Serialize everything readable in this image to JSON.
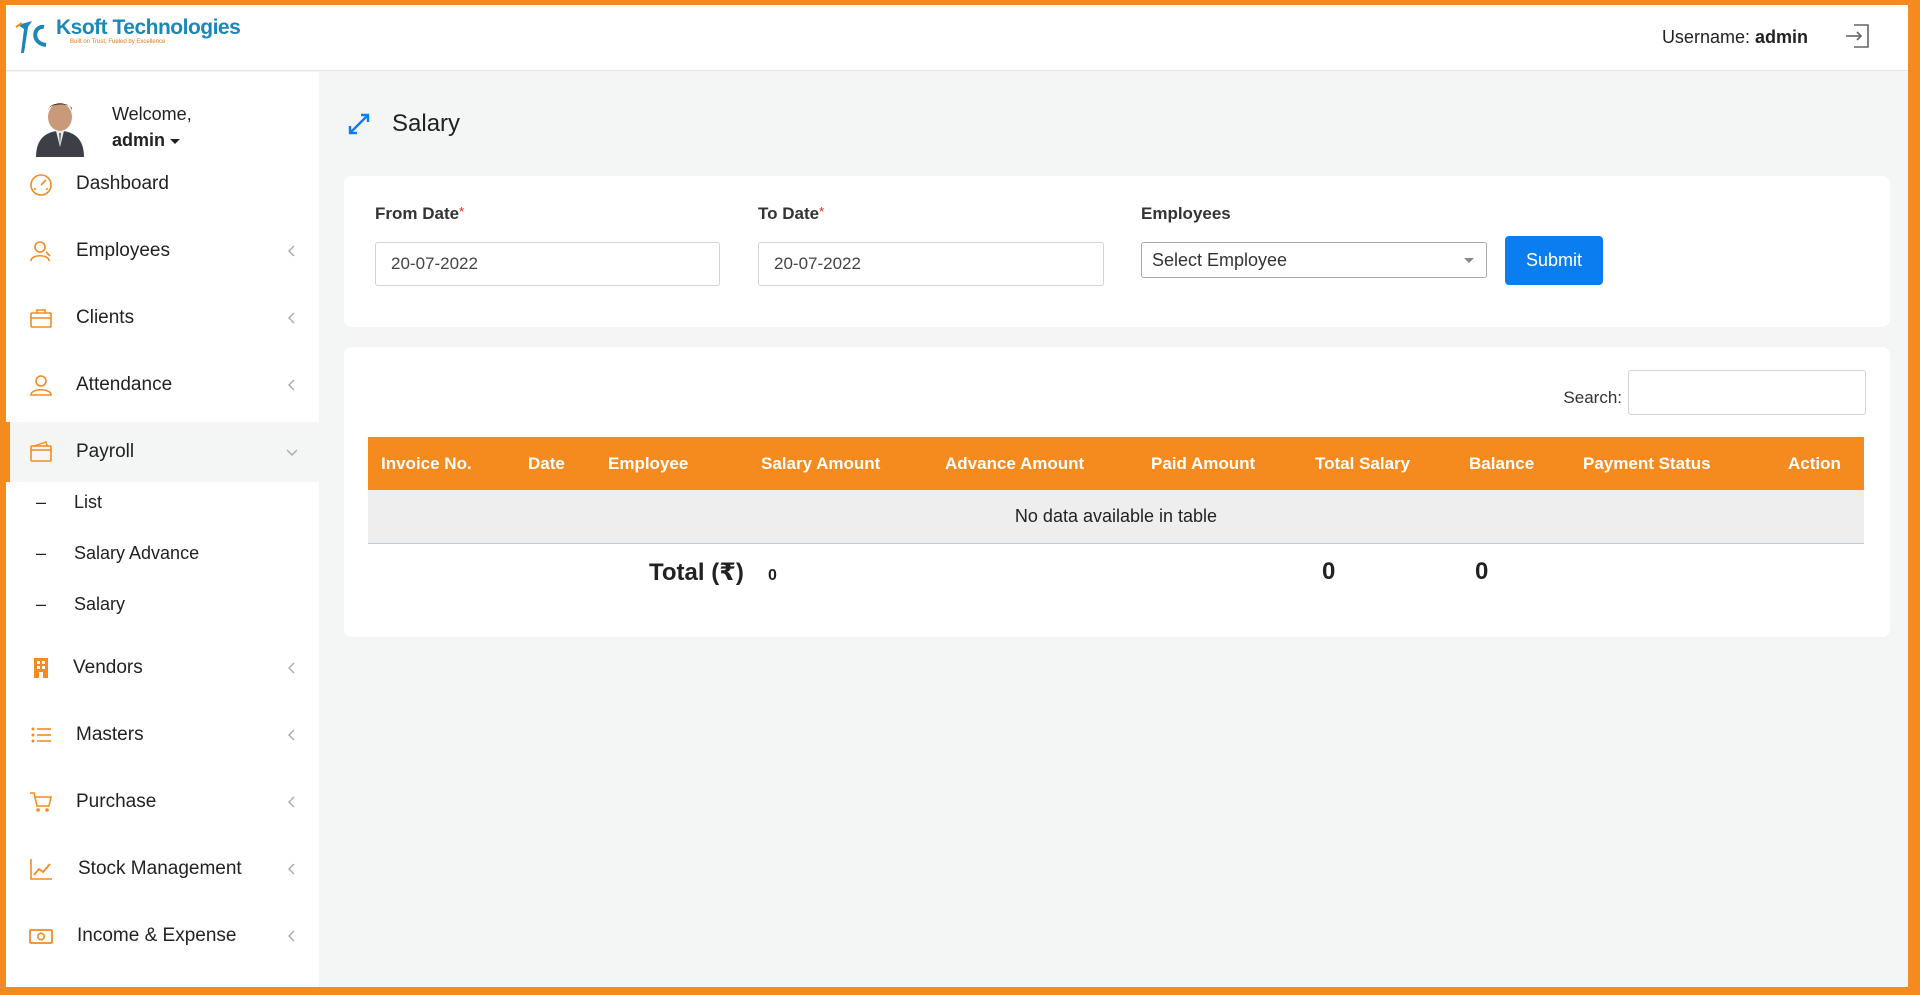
{
  "brand": {
    "name": "Ksoft Technologies",
    "tagline": "Built on Trust, Fueled by Excellence"
  },
  "header": {
    "username_label": "Username:",
    "username": "admin"
  },
  "sidebar": {
    "welcome": "Welcome,",
    "user": "admin",
    "items": [
      {
        "label": "Dashboard",
        "icon": "dashboard-gauge-icon"
      },
      {
        "label": "Employees",
        "icon": "employees-icon"
      },
      {
        "label": "Clients",
        "icon": "briefcase-icon"
      },
      {
        "label": "Attendance",
        "icon": "user-icon"
      },
      {
        "label": "Payroll",
        "icon": "wallet-icon"
      },
      {
        "label": "Vendors",
        "icon": "building-icon"
      },
      {
        "label": "Masters",
        "icon": "list-icon"
      },
      {
        "label": "Purchase",
        "icon": "cart-icon"
      },
      {
        "label": "Stock Management",
        "icon": "line-chart-icon"
      },
      {
        "label": "Income & Expense",
        "icon": "money-icon"
      }
    ],
    "payroll_sub": [
      {
        "dash": "–",
        "label": "List"
      },
      {
        "dash": "–",
        "label": "Salary Advance"
      },
      {
        "dash": "–",
        "label": "Salary"
      }
    ]
  },
  "page": {
    "title": "Salary"
  },
  "filters": {
    "from_date_label": "From Date",
    "from_date_value": "20-07-2022",
    "to_date_label": "To Date",
    "to_date_value": "20-07-2022",
    "required_mark": "*",
    "employees_label": "Employees",
    "employees_selected": "Select Employee",
    "submit_label": "Submit"
  },
  "table": {
    "search_label": "Search:",
    "columns": [
      "Invoice No.",
      "Date",
      "Employee",
      "Salary Amount",
      "Advance Amount",
      "Paid Amount",
      "Total Salary",
      "Balance",
      "Payment Status",
      "Action"
    ],
    "empty_message": "No data available in table",
    "total_label": "Total (₹)",
    "total_salary_amount": "0",
    "total_total_salary": "0",
    "total_balance": "0"
  },
  "colors": {
    "accent": "#f58a1f",
    "primary_button": "#0a7ef0",
    "brand_blue": "#1b88b8"
  }
}
